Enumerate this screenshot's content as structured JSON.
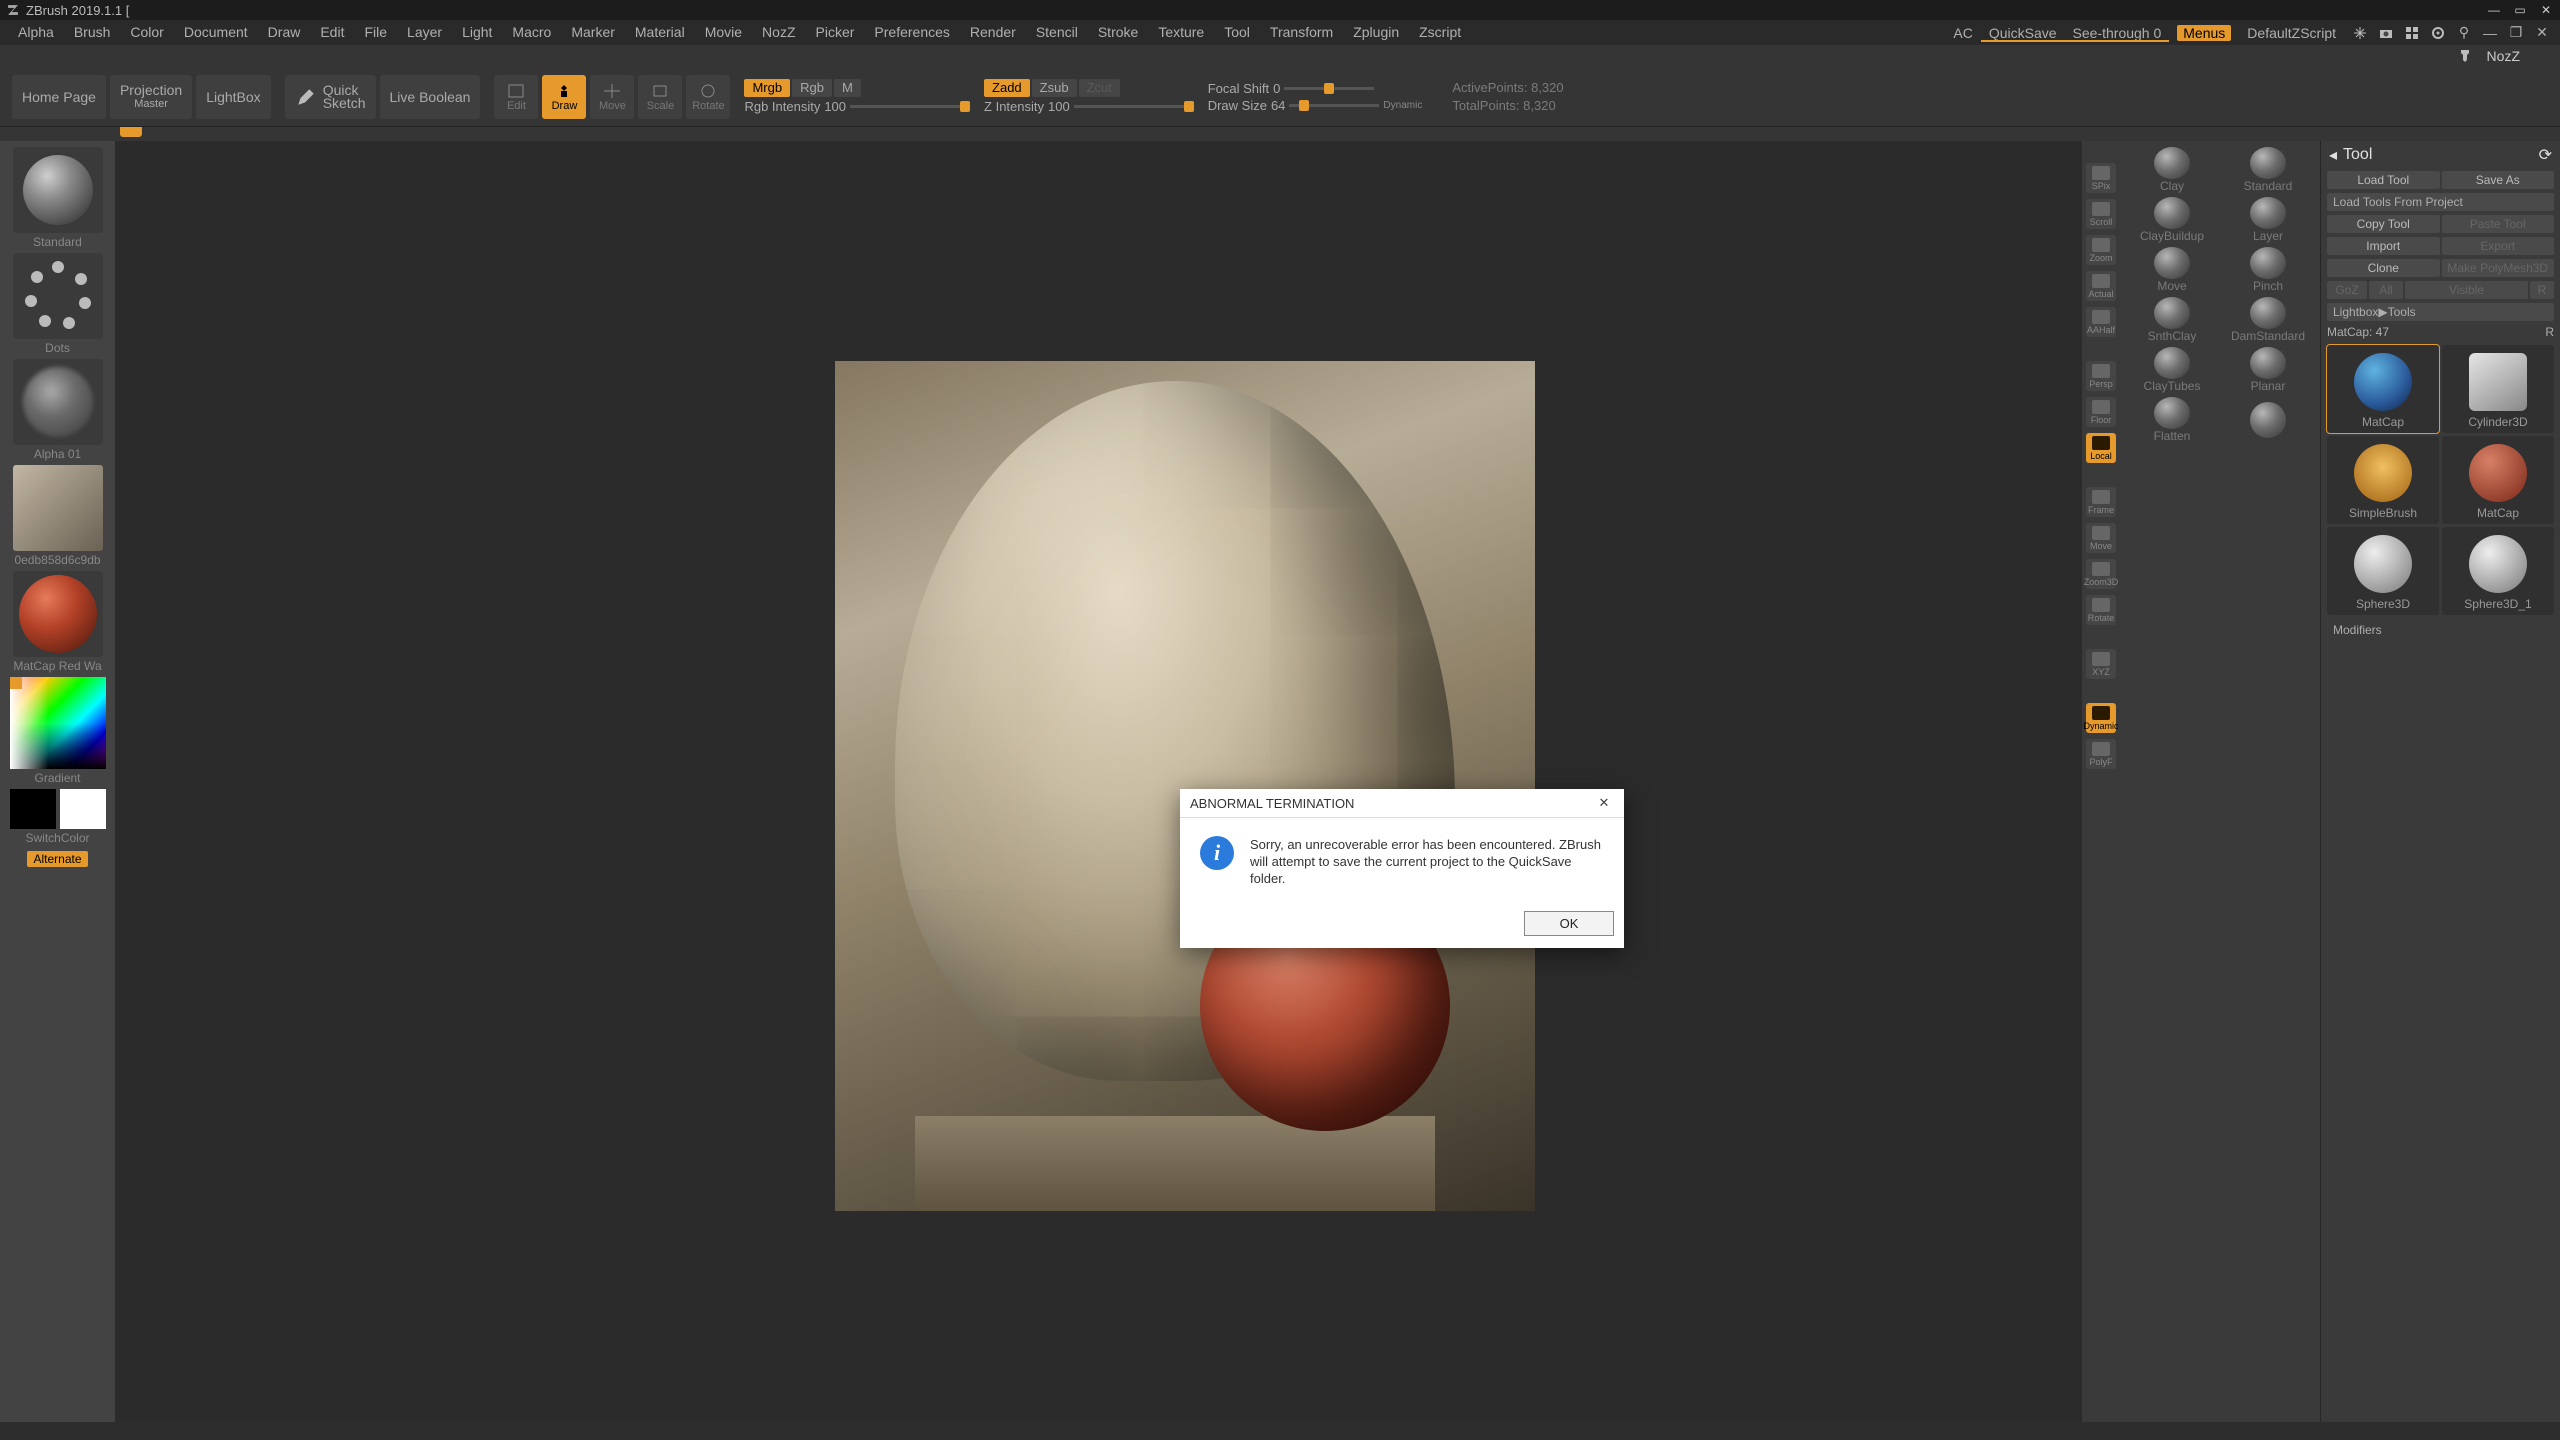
{
  "title": "ZBrush 2019.1.1 [",
  "menus": [
    "Alpha",
    "Brush",
    "Color",
    "Document",
    "Draw",
    "Edit",
    "File",
    "Layer",
    "Light",
    "Macro",
    "Marker",
    "Material",
    "Movie",
    "NozZ",
    "Picker",
    "Preferences",
    "Render",
    "Stencil",
    "Stroke",
    "Texture",
    "Tool",
    "Transform",
    "Zplugin",
    "Zscript"
  ],
  "topright": {
    "ac": "AC",
    "quicksave": "QuickSave",
    "seethrough": "See-through  0",
    "menus": "Menus",
    "defaultzscript": "DefaultZScript"
  },
  "menubar2": {
    "nozz": "NozZ"
  },
  "shelf": {
    "home": "Home Page",
    "proj1": "Projection",
    "proj2": "Master",
    "lightbox": "LightBox",
    "quicksketch1": "Quick",
    "quicksketch2": "Sketch",
    "liveboolean": "Live Boolean",
    "edit": "Edit",
    "draw": "Draw",
    "move": "Move",
    "scale": "Scale",
    "rotate": "Rotate",
    "mrgb": "Mrgb",
    "rgb": "Rgb",
    "m": "M",
    "zadd": "Zadd",
    "zsub": "Zsub",
    "zcut": "Zcut",
    "rgbint_l": "Rgb Intensity",
    "rgbint_v": "100",
    "zint_l": "Z Intensity",
    "zint_v": "100",
    "focal_l": "Focal Shift",
    "focal_v": "0",
    "draw_l": "Draw Size",
    "draw_v": "64",
    "dynamic": "Dynamic",
    "active": "ActivePoints: 8,320",
    "total": "TotalPoints: 8,320"
  },
  "left": {
    "standard": "Standard",
    "dots": "Dots",
    "alpha": "Alpha 01",
    "photo": "0edb858d6c9db",
    "material": "MatCap Red Wa",
    "gradient": "Gradient",
    "switch": "SwitchColor",
    "alternate": "Alternate"
  },
  "rcol": [
    "",
    "SPix",
    "Scroll",
    "Zoom",
    "Actual",
    "AAHalf",
    "",
    "Persp",
    "Floor",
    "Local",
    "",
    "Frame",
    "Move",
    "Zoom3D",
    "Rotate",
    "",
    "XYZ",
    "",
    "Dynamic",
    "PolyF",
    "",
    ""
  ],
  "rcol_active": [
    9,
    18
  ],
  "brushes": [
    "Clay",
    "Standard",
    "ClayBuildup",
    "Layer",
    "Move",
    "Pinch",
    "SnthClay",
    "DamStandard",
    "ClayTubes",
    "Planar",
    "Flatten",
    ""
  ],
  "tool": {
    "title": "Tool",
    "load": "Load Tool",
    "saveas": "Save As",
    "loadfrom": "Load Tools From Project",
    "copy": "Copy Tool",
    "paste": "Paste Tool",
    "import": "Import",
    "export": "Export",
    "clone": "Clone",
    "makepm": "Make PolyMesh3D",
    "goz": "GoZ",
    "all": "All",
    "visible": "Visible",
    "r": "R",
    "lightbox": "Lightbox▶Tools",
    "matcap_l": "MatCap: 47",
    "matcap_r": "R",
    "tools": [
      "MatCap",
      "Cylinder3D",
      "SimpleBrush",
      "MatCap",
      "Sphere3D",
      "Sphere3D_1"
    ],
    "modifiers": "Modifiers"
  },
  "modal": {
    "title": "ABNORMAL TERMINATION",
    "msg": "Sorry, an unrecoverable error has been encountered. ZBrush will attempt to save the current project to the QuickSave folder.",
    "ok": "OK"
  }
}
